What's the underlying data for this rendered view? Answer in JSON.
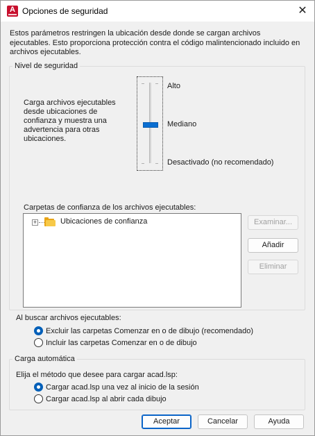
{
  "window": {
    "title": "Opciones de seguridad",
    "app_icon_letter": "A",
    "close_glyph": "✕"
  },
  "intro_text": "Estos parámetros restringen la ubicación desde donde se cargan archivos ejecutables. Esto proporciona protección contra el código malintencionado incluido en archivos ejecutables.",
  "security_level": {
    "legend": "Nivel de seguridad",
    "description": "Carga archivos ejecutables desde ubicaciones de confianza y muestra una advertencia para otras ubicaciones.",
    "levels": [
      "Alto",
      "Mediano",
      "Desactivado (no recomendado)"
    ],
    "selected_level": "Mediano",
    "trusted_folders_label": "Carpetas de confianza de los archivos ejecutables:",
    "tree_root": "Ubicaciones de confianza",
    "expander_glyph": "+",
    "buttons": {
      "browse": "Examinar...",
      "add": "Añadir",
      "remove": "Eliminar"
    },
    "search_label": "Al buscar archivos ejecutables:",
    "search_options": [
      {
        "label": "Excluir las carpetas Comenzar en o de dibujo (recomendado)",
        "checked": true
      },
      {
        "label": "Incluir las carpetas Comenzar en o de dibujo",
        "checked": false
      }
    ]
  },
  "autoload": {
    "legend": "Carga automática",
    "prompt": "Elija el método que desee para cargar acad.lsp:",
    "options": [
      {
        "label": "Cargar acad.lsp una vez al inicio de la sesión",
        "checked": true
      },
      {
        "label": "Cargar acad.lsp al abrir cada dibujo",
        "checked": false
      }
    ]
  },
  "footer": {
    "ok": "Aceptar",
    "cancel": "Cancelar",
    "help": "Ayuda"
  },
  "colors": {
    "accent": "#005fb8",
    "app_icon": "#c8102e",
    "slider_thumb": "#0a6ed1"
  }
}
